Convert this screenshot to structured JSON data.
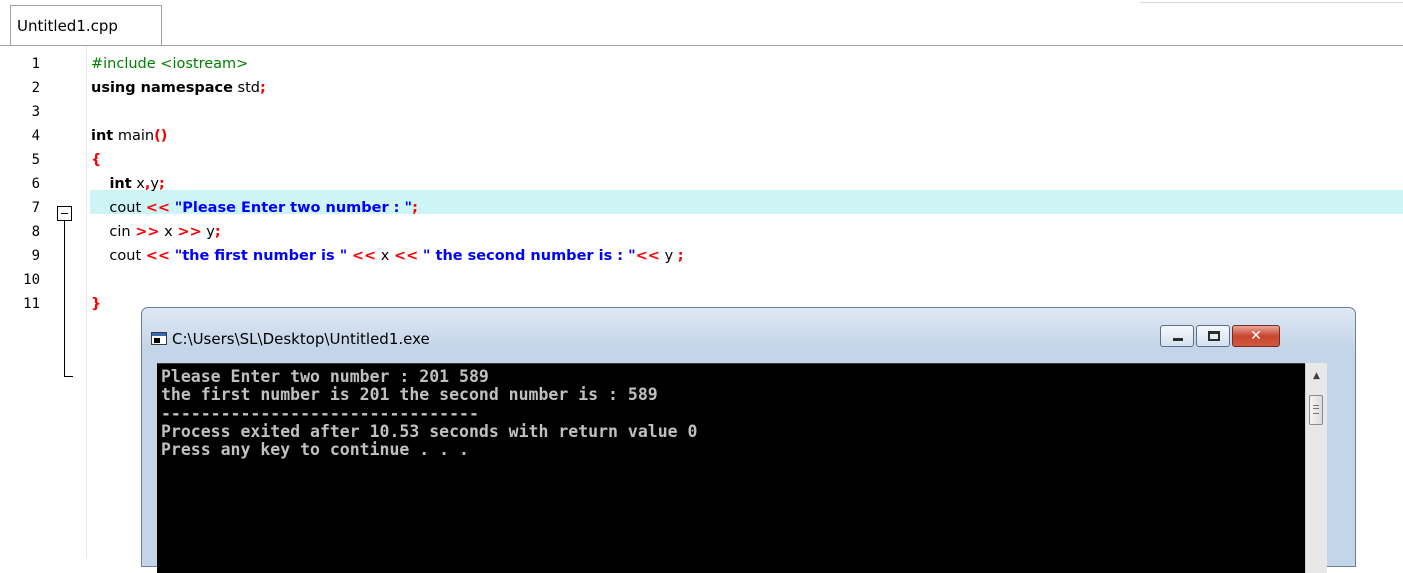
{
  "tab": {
    "label": "Untitled1.cpp"
  },
  "gutter": {
    "line_numbers": [
      "1",
      "2",
      "3",
      "4",
      "5",
      "6",
      "7",
      "8",
      "9",
      "10",
      "11"
    ]
  },
  "code": {
    "lines": [
      [
        {
          "c": "pre",
          "t": "#include <iostream>"
        }
      ],
      [
        {
          "c": "kw",
          "t": "using namespace"
        },
        {
          "c": "",
          "t": " std"
        },
        {
          "c": "sym",
          "t": ";"
        }
      ],
      [],
      [
        {
          "c": "kw",
          "t": "int"
        },
        {
          "c": "",
          "t": " main"
        },
        {
          "c": "sym",
          "t": "()"
        }
      ],
      [
        {
          "c": "sym",
          "t": "{"
        }
      ],
      [
        {
          "c": "",
          "t": "    "
        },
        {
          "c": "kw",
          "t": "int"
        },
        {
          "c": "",
          "t": " x"
        },
        {
          "c": "sym",
          "t": ","
        },
        {
          "c": "",
          "t": "y"
        },
        {
          "c": "sym",
          "t": ";"
        }
      ],
      [
        {
          "c": "",
          "t": "    cout "
        },
        {
          "c": "sym",
          "t": "<<"
        },
        {
          "c": "",
          "t": " "
        },
        {
          "c": "str",
          "t": "\"Please Enter two number : \""
        },
        {
          "c": "sym",
          "t": ";"
        }
      ],
      [
        {
          "c": "",
          "t": "    cin "
        },
        {
          "c": "sym",
          "t": ">>"
        },
        {
          "c": "",
          "t": " x "
        },
        {
          "c": "sym",
          "t": ">>"
        },
        {
          "c": "",
          "t": " y"
        },
        {
          "c": "sym",
          "t": ";"
        }
      ],
      [
        {
          "c": "",
          "t": "    cout "
        },
        {
          "c": "sym",
          "t": "<<"
        },
        {
          "c": "",
          "t": " "
        },
        {
          "c": "str",
          "t": "\"the first number is \""
        },
        {
          "c": "",
          "t": " "
        },
        {
          "c": "sym",
          "t": "<<"
        },
        {
          "c": "",
          "t": " x "
        },
        {
          "c": "sym",
          "t": "<<"
        },
        {
          "c": "",
          "t": " "
        },
        {
          "c": "str",
          "t": "\" the second number is : \""
        },
        {
          "c": "sym",
          "t": "<<"
        },
        {
          "c": "",
          "t": " y "
        },
        {
          "c": "sym",
          "t": ";"
        }
      ],
      [],
      [
        {
          "c": "sym",
          "t": "}"
        }
      ]
    ]
  },
  "console": {
    "title": "C:\\Users\\SL\\Desktop\\Untitled1.exe",
    "output": [
      "Please Enter two number : 201 589",
      "the first number is 201 the second number is : 589",
      "--------------------------------",
      "Process exited after 10.53 seconds with return value 0",
      "Press any key to continue . . ."
    ]
  },
  "colors": {
    "keyword": "#000000",
    "preprocessor": "#008000",
    "symbol": "#ff0000",
    "string": "#0000ff",
    "current_line_highlight": "#cdf5f5"
  }
}
